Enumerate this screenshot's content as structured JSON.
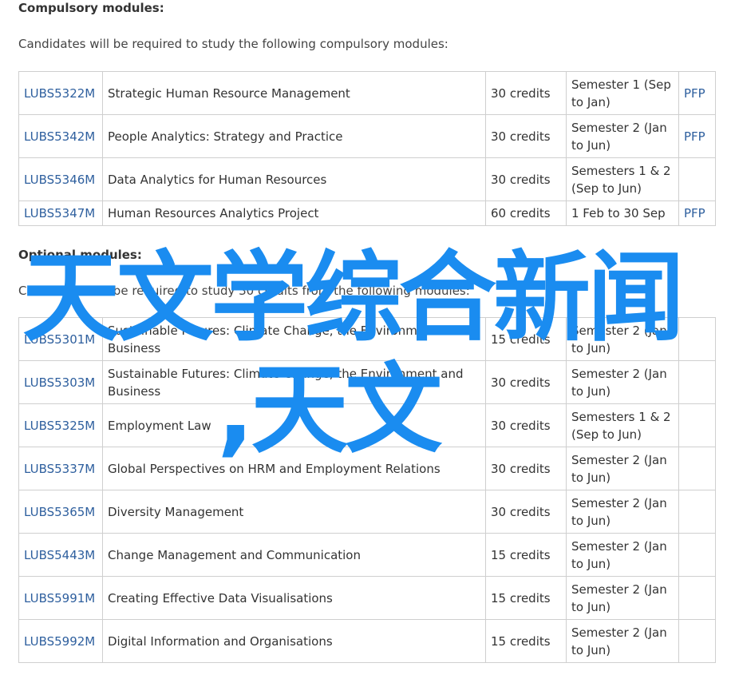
{
  "compulsory": {
    "heading": "Compulsory modules:",
    "intro": "Candidates will be required to study the following compulsory modules:",
    "rows": [
      {
        "code": "LUBS5322M",
        "title": "Strategic Human Resource Management",
        "credits": "30 credits",
        "semester": "Semester 1 (Sep to Jan)",
        "pfp": "PFP"
      },
      {
        "code": "LUBS5342M",
        "title": "People Analytics: Strategy and Practice",
        "credits": "30 credits",
        "semester": "Semester 2 (Jan to Jun)",
        "pfp": "PFP"
      },
      {
        "code": "LUBS5346M",
        "title": "Data Analytics for Human Resources",
        "credits": "30 credits",
        "semester": "Semesters 1 & 2 (Sep to Jun)",
        "pfp": ""
      },
      {
        "code": "LUBS5347M",
        "title": "Human Resources Analytics Project",
        "credits": "60 credits",
        "semester": "1 Feb to 30 Sep",
        "pfp": "PFP"
      }
    ]
  },
  "optional": {
    "heading": "Optional modules:",
    "intro": "Candidates will be required to study 30 credits from the following modules:",
    "rows": [
      {
        "code": "LUBS5301M",
        "title": "Sustainable Futures: Climate Change, the Environment and Business",
        "credits": "15 credits",
        "semester": "Semester 2 (Jan to Jun)",
        "pfp": ""
      },
      {
        "code": "LUBS5303M",
        "title": "Sustainable Futures: Climate Change, the Environment and Business",
        "credits": "30 credits",
        "semester": "Semester 2 (Jan to Jun)",
        "pfp": ""
      },
      {
        "code": "LUBS5325M",
        "title": "Employment Law",
        "credits": "30 credits",
        "semester": "Semesters 1 & 2 (Sep to Jun)",
        "pfp": ""
      },
      {
        "code": "LUBS5337M",
        "title": "Global Perspectives on HRM and Employment Relations",
        "credits": "30 credits",
        "semester": "Semester 2 (Jan to Jun)",
        "pfp": ""
      },
      {
        "code": "LUBS5365M",
        "title": "Diversity Management",
        "credits": "30 credits",
        "semester": "Semester 2 (Jan to Jun)",
        "pfp": ""
      },
      {
        "code": "LUBS5443M",
        "title": "Change Management and Communication",
        "credits": "15 credits",
        "semester": "Semester 2 (Jan to Jun)",
        "pfp": ""
      },
      {
        "code": "LUBS5991M",
        "title": "Creating Effective Data Visualisations",
        "credits": "15 credits",
        "semester": "Semester 2 (Jan to Jun)",
        "pfp": ""
      },
      {
        "code": "LUBS5992M",
        "title": "Digital Information and Organisations",
        "credits": "15 credits",
        "semester": "Semester 2 (Jan to Jun)",
        "pfp": ""
      }
    ]
  },
  "overlay": {
    "line1": "天文学综合新闻",
    "line2": ",天文",
    "color": "#1a8cf0"
  },
  "colors": {
    "link": "#2e5f9e",
    "border": "#cfcfcf"
  }
}
